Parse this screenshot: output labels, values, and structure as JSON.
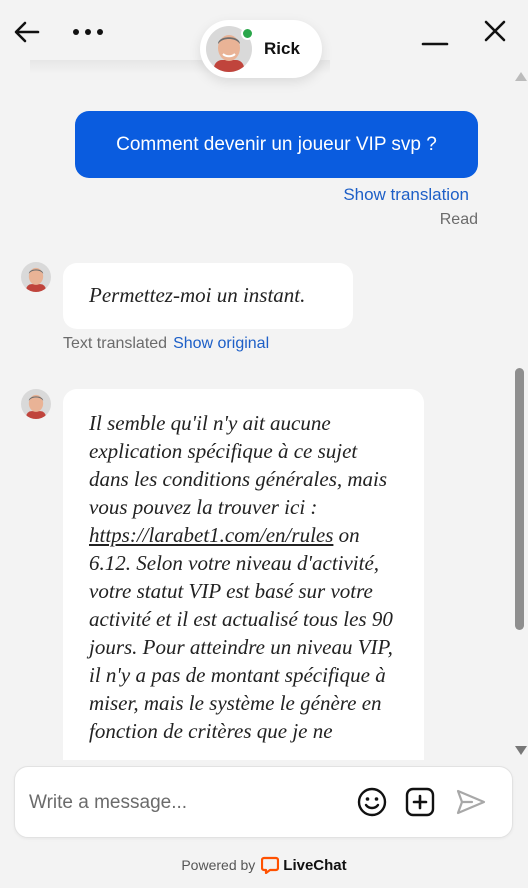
{
  "header": {
    "agent_name": "Rick",
    "status": "online"
  },
  "icons": {
    "back": "arrow-left-icon",
    "more": "more-dots-icon",
    "minimize": "minimize-icon",
    "close": "close-icon",
    "emoji": "emoji-icon",
    "attach": "attach-plus-icon",
    "send": "send-icon",
    "brand": "livechat-logo-icon"
  },
  "messages": {
    "outgoing_text": "Comment devenir un joueur VIP svp ?",
    "show_translation": "Show translation",
    "read_status": "Read",
    "incoming_1_text": "Permettez-moi un instant.",
    "text_translated": "Text translated",
    "show_original": "Show original",
    "incoming_2_part1": "Il semble qu'il n'y ait aucune explication spécifique à ce sujet dans les conditions générales, mais vous pouvez la trouver ici : ",
    "incoming_2_link": "https://larabet1.com/en/rules",
    "incoming_2_part2": " on 6.12. Selon votre niveau d'activité, votre statut VIP est basé sur votre activité et il est actualisé tous les 90 jours. Pour atteindre un niveau VIP, il n'y a pas de montant spécifique à miser, mais le système le génère en fonction de critères que je ne"
  },
  "composer": {
    "placeholder": "Write a message..."
  },
  "footer": {
    "powered_by": "Powered by",
    "brand": "LiveChat"
  },
  "colors": {
    "accent": "#0a5cdf",
    "link": "#1d5fc7",
    "online": "#2aa64a",
    "brand": "#ff5100"
  }
}
